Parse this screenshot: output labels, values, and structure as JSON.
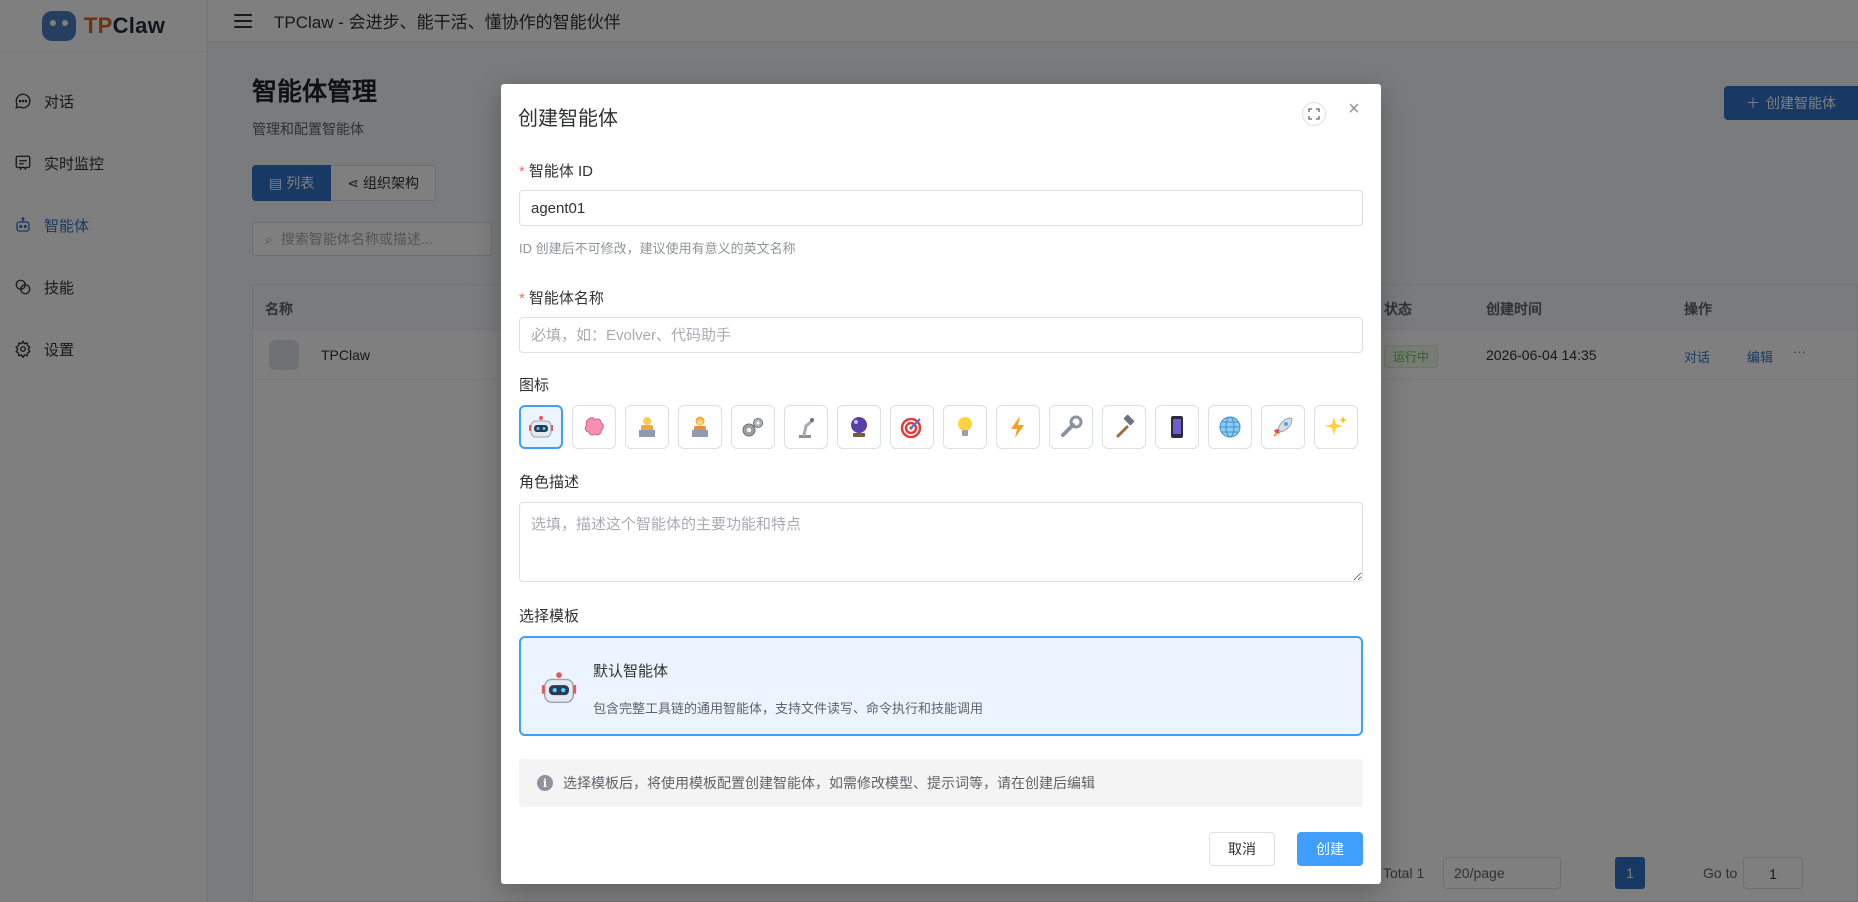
{
  "app": {
    "logo_prefix": "TP",
    "logo_suffix": "Claw",
    "header_title": "TPClaw - 会进步、能干活、懂协作的智能伙伴"
  },
  "sidebar": {
    "items": [
      {
        "label": "对话",
        "icon": "chat-icon",
        "active": false
      },
      {
        "label": "实时监控",
        "icon": "monitor-icon",
        "active": false
      },
      {
        "label": "智能体",
        "icon": "robot-icon",
        "active": true
      },
      {
        "label": "技能",
        "icon": "skills-icon",
        "active": false
      },
      {
        "label": "设置",
        "icon": "gear-icon",
        "active": false
      }
    ]
  },
  "page": {
    "title": "智能体管理",
    "subtitle": "管理和配置智能体",
    "create_label": "创建智能体",
    "view_list": "列表",
    "view_org": "组织架构",
    "search_placeholder": "搜索智能体名称或描述..."
  },
  "table": {
    "columns": {
      "name": "名称",
      "status": "状态",
      "created": "创建时间",
      "actions": "操作"
    },
    "rows": [
      {
        "name": "TPClaw",
        "status": "运行中",
        "created": "2026-06-04 14:35",
        "action_chat": "对话",
        "action_edit": "编辑",
        "action_more": "···"
      }
    ],
    "pagination": {
      "total": "Total 1",
      "page_size": "20/page",
      "current": "1",
      "goto_label": "Go to",
      "goto_value": "1"
    }
  },
  "modal": {
    "title": "创建智能体",
    "id_label": "智能体 ID",
    "id_value": "agent01",
    "id_hint": "ID 创建后不可修改，建议使用有意义的英文名称",
    "name_label": "智能体名称",
    "name_placeholder": "必填，如：Evolver、代码助手",
    "icon_label": "图标",
    "icons": [
      "robot-icon",
      "brain-icon",
      "technologist-icon",
      "woman-technologist-icon",
      "gears-icon",
      "robot-arm-icon",
      "crystal-ball-icon",
      "target-icon",
      "lightbulb-icon",
      "lightning-icon",
      "wrench-icon",
      "hammer-icon",
      "phone-icon",
      "globe-icon",
      "rocket-icon",
      "sparkles-icon"
    ],
    "selected_icon_index": 0,
    "desc_label": "角色描述",
    "desc_placeholder": "选填，描述这个智能体的主要功能和特点",
    "template_label": "选择模板",
    "template_name": "默认智能体",
    "template_desc": "包含完整工具链的通用智能体，支持文件读写、命令执行和技能调用",
    "notice": "选择模板后，将使用模板配置创建智能体，如需修改模型、提示词等，请在创建后编辑",
    "cancel_label": "取消",
    "create_label": "创建"
  },
  "colors": {
    "primary": "#2f73c9",
    "modal_primary": "#409eff",
    "logo_accent": "#e0631d",
    "required": "#f56c6c"
  }
}
